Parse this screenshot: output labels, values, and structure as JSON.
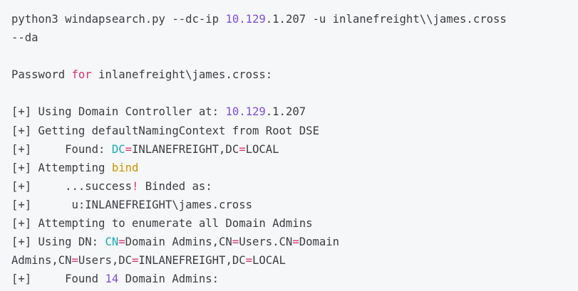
{
  "colors": {
    "background": "#f6f7f8",
    "text": "#3a3d42",
    "number": "#7b4fd6",
    "keyword": "#d6336c",
    "attribute": "#1aa7b3",
    "builtin": "#c99500"
  },
  "lines": [
    {
      "kind": "text",
      "tokens": [
        {
          "t": "python3 windapsearch.py --dc-ip ",
          "c": ""
        },
        {
          "t": "10.129",
          "c": "n"
        },
        {
          "t": ".1.207 -u inlanefreight\\\\james.cross",
          "c": ""
        }
      ]
    },
    {
      "kind": "text",
      "tokens": [
        {
          "t": "--da",
          "c": ""
        }
      ]
    },
    {
      "kind": "blank",
      "tokens": []
    },
    {
      "kind": "text",
      "tokens": [
        {
          "t": "Password ",
          "c": ""
        },
        {
          "t": "for",
          "c": "k"
        },
        {
          "t": " inlanefreight\\james.cross:",
          "c": ""
        }
      ]
    },
    {
      "kind": "blank",
      "tokens": []
    },
    {
      "kind": "text",
      "tokens": [
        {
          "t": "[+] Using Domain Controller at: ",
          "c": ""
        },
        {
          "t": "10.129",
          "c": "n"
        },
        {
          "t": ".1.207",
          "c": ""
        }
      ]
    },
    {
      "kind": "text",
      "tokens": [
        {
          "t": "[+] Getting defaultNamingContext from Root DSE",
          "c": ""
        }
      ]
    },
    {
      "kind": "text",
      "tokens": [
        {
          "t": "[+]     Found: ",
          "c": ""
        },
        {
          "t": "DC",
          "c": "t"
        },
        {
          "t": "=",
          "c": "k"
        },
        {
          "t": "INLANEFREIGHT,DC",
          "c": ""
        },
        {
          "t": "=",
          "c": "k"
        },
        {
          "t": "LOCAL",
          "c": ""
        }
      ]
    },
    {
      "kind": "text",
      "tokens": [
        {
          "t": "[+] Attempting ",
          "c": ""
        },
        {
          "t": "bind",
          "c": "y"
        }
      ]
    },
    {
      "kind": "text",
      "tokens": [
        {
          "t": "[+]     ...success",
          "c": ""
        },
        {
          "t": "!",
          "c": "k"
        },
        {
          "t": " Binded as:",
          "c": ""
        }
      ]
    },
    {
      "kind": "text",
      "tokens": [
        {
          "t": "[+]      u:INLANEFREIGHT\\james.cross",
          "c": ""
        }
      ]
    },
    {
      "kind": "text",
      "tokens": [
        {
          "t": "[+] Attempting to enumerate all Domain Admins",
          "c": ""
        }
      ]
    },
    {
      "kind": "text",
      "tokens": [
        {
          "t": "[+] Using DN: ",
          "c": ""
        },
        {
          "t": "CN",
          "c": "t"
        },
        {
          "t": "=",
          "c": "k"
        },
        {
          "t": "Domain Admins,CN",
          "c": ""
        },
        {
          "t": "=",
          "c": "k"
        },
        {
          "t": "Users.CN",
          "c": ""
        },
        {
          "t": "=",
          "c": "k"
        },
        {
          "t": "Domain",
          "c": ""
        }
      ]
    },
    {
      "kind": "text",
      "tokens": [
        {
          "t": "Admins,CN",
          "c": ""
        },
        {
          "t": "=",
          "c": "k"
        },
        {
          "t": "Users,DC",
          "c": ""
        },
        {
          "t": "=",
          "c": "k"
        },
        {
          "t": "INLANEFREIGHT,DC",
          "c": ""
        },
        {
          "t": "=",
          "c": "k"
        },
        {
          "t": "LOCAL",
          "c": ""
        }
      ]
    },
    {
      "kind": "text",
      "tokens": [
        {
          "t": "[+]     Found ",
          "c": ""
        },
        {
          "t": "14",
          "c": "n"
        },
        {
          "t": " Domain Admins:",
          "c": ""
        }
      ]
    }
  ]
}
